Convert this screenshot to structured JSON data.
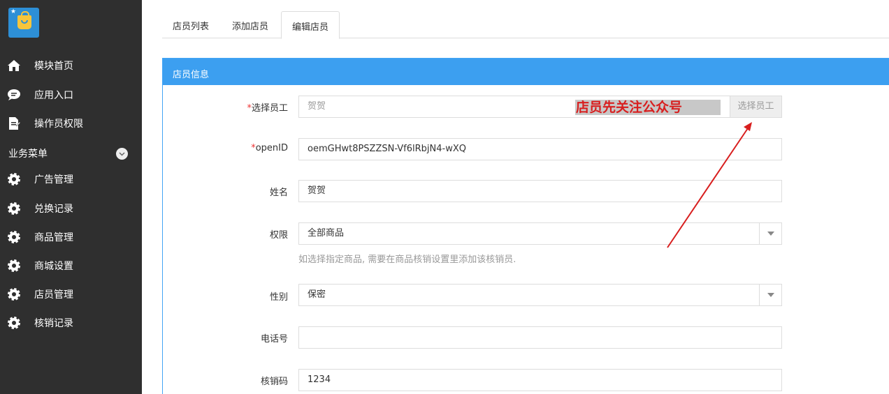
{
  "sidebar": {
    "logo_icon": "shopping-bag-icon",
    "items_top": [
      {
        "label": "模块首页",
        "icon": "home-icon"
      },
      {
        "label": "应用入口",
        "icon": "chat-bubble-icon"
      },
      {
        "label": "操作员权限",
        "icon": "document-edit-icon"
      }
    ],
    "section_label": "业务菜单",
    "items_business": [
      {
        "label": "广告管理",
        "icon": "gear-icon"
      },
      {
        "label": "兑换记录",
        "icon": "gear-icon"
      },
      {
        "label": "商品管理",
        "icon": "gear-icon"
      },
      {
        "label": "商城设置",
        "icon": "gear-icon"
      },
      {
        "label": "店员管理",
        "icon": "gear-icon"
      },
      {
        "label": "核销记录",
        "icon": "gear-icon"
      }
    ]
  },
  "tabs": [
    {
      "label": "店员列表"
    },
    {
      "label": "添加店员"
    },
    {
      "label": "编辑店员",
      "active": true
    }
  ],
  "panel": {
    "title": "店员信息",
    "fields": {
      "employee": {
        "required_mark": "*",
        "label": "选择员工",
        "placeholder": "贺贺",
        "button": "选择员工"
      },
      "openid": {
        "required_mark": "*",
        "label": "openID",
        "value": "oemGHwt8PSZZSN-Vf6lRbjN4-wXQ"
      },
      "name": {
        "label": "姓名",
        "value": "贺贺"
      },
      "permission": {
        "label": "权限",
        "value": "全部商品",
        "help": "如选择指定商品, 需要在商品核销设置里添加该核销员."
      },
      "gender": {
        "label": "性别",
        "value": "保密"
      },
      "phone": {
        "label": "电话号",
        "value": ""
      },
      "code": {
        "label": "核销码",
        "value": "1234"
      }
    }
  },
  "annotation": {
    "text": "店员先关注公众号",
    "color": "#d81e1e"
  },
  "colors": {
    "sidebar": "#2f2f2f",
    "accent": "#3c9ff0"
  }
}
